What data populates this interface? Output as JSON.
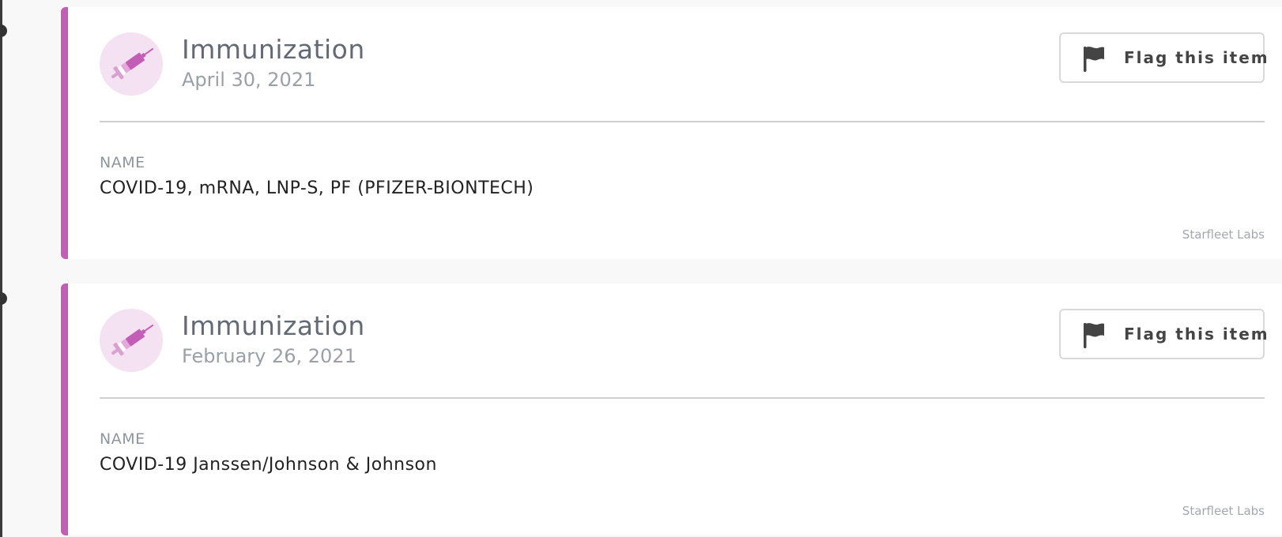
{
  "colors": {
    "accent": "#c45db5",
    "icon_bg": "#f4e1f1",
    "title": "#646a74",
    "muted": "#9aa0a8"
  },
  "cards": [
    {
      "icon": "syringe-icon",
      "title": "Immunization",
      "date": "April 30, 2021",
      "flag_label": "Flag this item",
      "field_label": "NAME",
      "field_value": "COVID-19, mRNA, LNP-S, PF (PFIZER-BIONTECH)",
      "source": "Starfleet Labs"
    },
    {
      "icon": "syringe-icon",
      "title": "Immunization",
      "date": "February 26, 2021",
      "flag_label": "Flag this item",
      "field_label": "NAME",
      "field_value": "COVID-19 Janssen/Johnson & Johnson",
      "source": "Starfleet Labs"
    }
  ]
}
